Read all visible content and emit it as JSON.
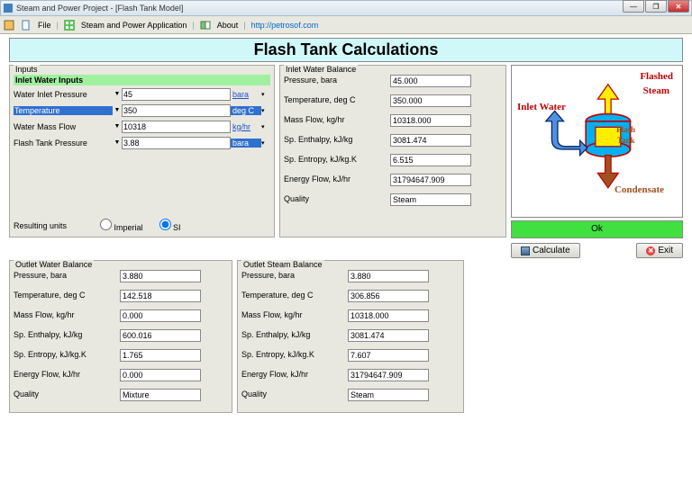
{
  "window": {
    "title": "Steam and Power Project - [Flash Tank Model]"
  },
  "menu": {
    "file": "File",
    "app": "Steam and Power Application",
    "about": "About",
    "link": "http://petrosof.com"
  },
  "page_title": "Flash Tank Calculations",
  "inputs": {
    "legend": "Inputs",
    "header": "Inlet Water Inputs",
    "rows": [
      {
        "label": "Water Inlet Pressure",
        "value": "45",
        "unit": "bara"
      },
      {
        "label": "Temperature",
        "value": "350",
        "unit": "deg C",
        "selected": true,
        "unit_sel": true
      },
      {
        "label": "Water Mass Flow",
        "value": "10318",
        "unit": "kg/hr"
      },
      {
        "label": "Flash Tank Pressure",
        "value": "3.88",
        "unit": "bara",
        "unit_sel": true
      }
    ],
    "units_label": "Resulting units",
    "imperial": "Imperial",
    "si": "SI"
  },
  "inlet_balance": {
    "legend": "Inlet Water Balance",
    "rows": [
      {
        "label": "Pressure, bara",
        "value": "45.000"
      },
      {
        "label": "Temperature, deg C",
        "value": "350.000"
      },
      {
        "label": "Mass Flow, kg/hr",
        "value": "10318.000"
      },
      {
        "label": "Sp. Enthalpy, kJ/kg",
        "value": "3081.474"
      },
      {
        "label": "Sp. Entropy, kJ/kg.K",
        "value": "6.515"
      },
      {
        "label": "Energy Flow, kJ/hr",
        "value": "31794647.909"
      },
      {
        "label": "Quality",
        "value": "Steam"
      }
    ]
  },
  "outlet_water": {
    "legend": "Outlet Water Balance",
    "rows": [
      {
        "label": "Pressure, bara",
        "value": "3.880"
      },
      {
        "label": "Temperature, deg C",
        "value": "142.518"
      },
      {
        "label": "Mass Flow, kg/hr",
        "value": "0.000"
      },
      {
        "label": "Sp. Enthalpy, kJ/kg",
        "value": "600.016"
      },
      {
        "label": "Sp. Entropy, kJ/kg.K",
        "value": "1.765"
      },
      {
        "label": "Energy Flow, kJ/hr",
        "value": "0.000"
      },
      {
        "label": "Quality",
        "value": "Mixture"
      }
    ]
  },
  "outlet_steam": {
    "legend": "Outlet Steam Balance",
    "rows": [
      {
        "label": "Pressure, bara",
        "value": "3.880"
      },
      {
        "label": "Temperature, deg C",
        "value": "306.856"
      },
      {
        "label": "Mass Flow, kg/hr",
        "value": "10318.000"
      },
      {
        "label": "Sp. Enthalpy, kJ/kg",
        "value": "3081.474"
      },
      {
        "label": "Sp. Entropy, kJ/kg.K",
        "value": "7.607"
      },
      {
        "label": "Energy Flow, kJ/hr",
        "value": "31794647.909"
      },
      {
        "label": "Quality",
        "value": "Steam"
      }
    ]
  },
  "diagram": {
    "inlet": "Inlet Water",
    "flashed": "Flashed",
    "steam": "Steam",
    "tank1": "Flash",
    "tank2": "Tank",
    "condensate": "Condensate"
  },
  "buttons": {
    "ok": "Ok",
    "calculate": "Calculate",
    "exit": "Exit"
  }
}
